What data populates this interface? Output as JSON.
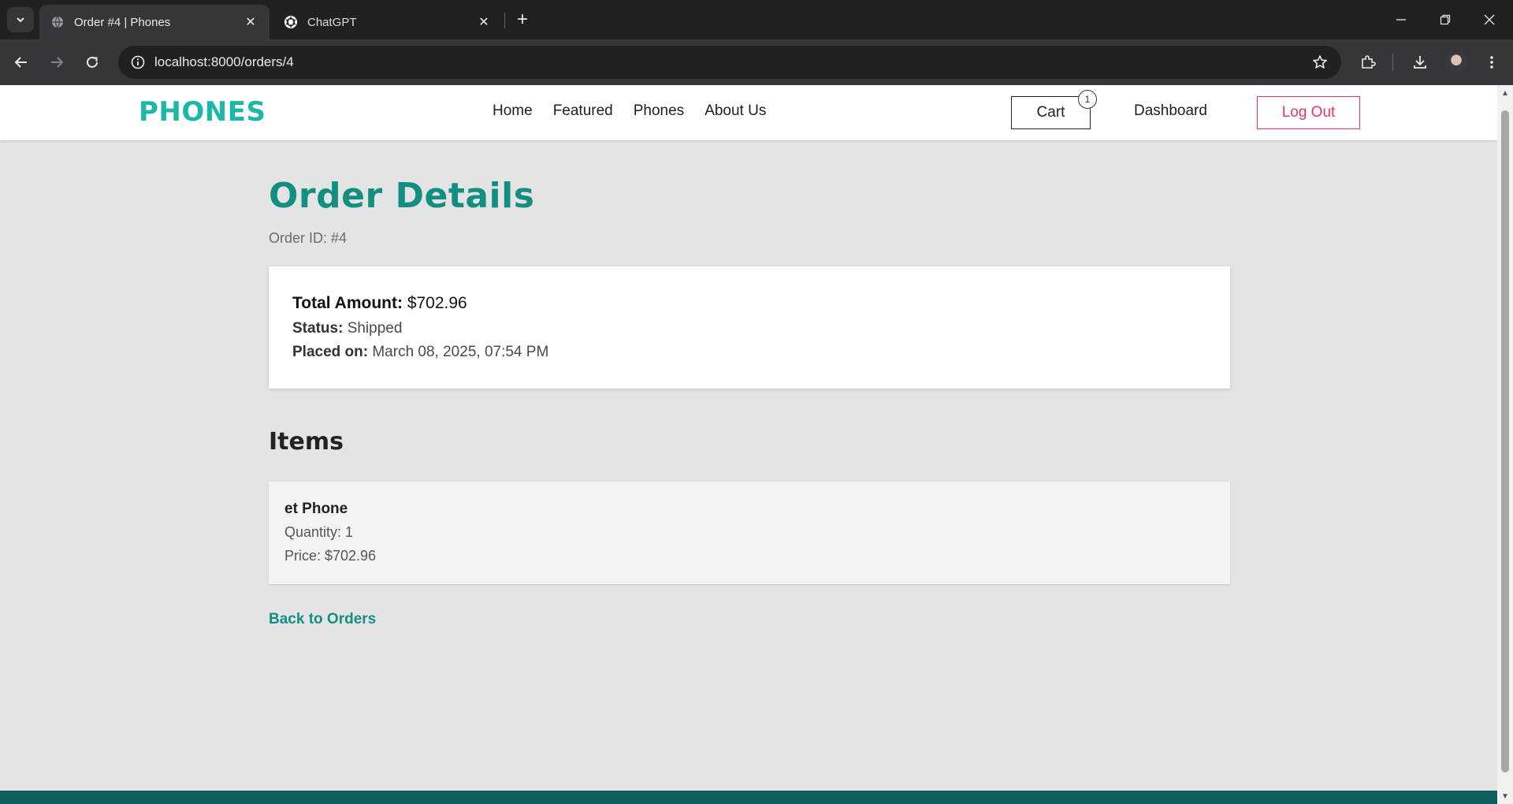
{
  "browser": {
    "tabs": [
      {
        "title": "Order #4 | Phones",
        "active": true,
        "icon": "globe-icon"
      },
      {
        "title": "ChatGPT",
        "active": false,
        "icon": "openai-icon"
      }
    ],
    "url": "localhost:8000/orders/4"
  },
  "site": {
    "logo": "PHONES",
    "nav": [
      "Home",
      "Featured",
      "Phones",
      "About Us"
    ],
    "cart_label": "Cart",
    "cart_count": "1",
    "dashboard_label": "Dashboard",
    "logout_label": "Log Out",
    "colors": {
      "brand": "#1cb8a6",
      "heading": "#138f82",
      "logout": "#e8336a",
      "footer": "#0e5f5c"
    }
  },
  "order": {
    "title": "Order Details",
    "id_text": "Order ID: #4",
    "total_label": "Total Amount:",
    "total_value": "$702.96",
    "status_label": "Status:",
    "status_value": "Shipped",
    "placed_label": "Placed on:",
    "placed_value": "March 08, 2025, 07:54 PM"
  },
  "items": {
    "heading": "Items",
    "list": [
      {
        "name": "et Phone",
        "quantity": "Quantity: 1",
        "price": "Price: $702.96"
      }
    ]
  },
  "back_link": "Back to Orders"
}
